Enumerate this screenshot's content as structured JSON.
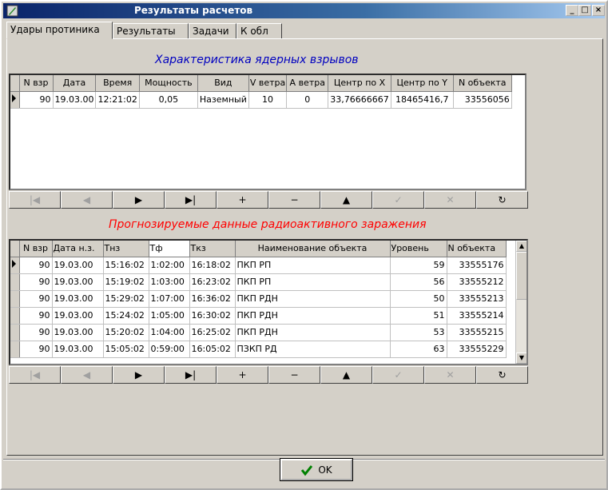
{
  "window": {
    "title": "Результаты расчетов"
  },
  "tabs": [
    {
      "label": "Удары протиника"
    },
    {
      "label": "Результаты"
    },
    {
      "label": "Задачи"
    },
    {
      "label": "К обл"
    }
  ],
  "explosions": {
    "title": "Характеристика ядерных взрывов",
    "title_color": "#0000c0",
    "columns": [
      "N взр",
      "Дата",
      "Время",
      "Мощность",
      "Вид",
      "V ветра",
      "A ветра",
      "Центр по X",
      "Центр по Y",
      "N объекта"
    ],
    "rows": [
      [
        "90",
        "19.03.00",
        "12:21:02",
        "0,05",
        "Наземный",
        "10",
        "0",
        "33,76666667",
        "18465416,7",
        "33556056"
      ]
    ]
  },
  "contamination": {
    "title": "Прогнозируемые данные радиоактивного заражения",
    "title_color": "#ff0000",
    "columns": [
      "N взр",
      "Дата н.з.",
      "Тнз",
      "Тф",
      "Ткз",
      "Наименование объекта",
      "Уровень",
      "N объекта"
    ],
    "rows": [
      [
        "90",
        "19.03.00",
        "15:16:02",
        "1:02:00",
        "16:18:02",
        "ПКП РП",
        "59",
        "33555176"
      ],
      [
        "90",
        "19.03.00",
        "15:19:02",
        "1:03:00",
        "16:23:02",
        "ПКП РП",
        "56",
        "33555212"
      ],
      [
        "90",
        "19.03.00",
        "15:29:02",
        "1:07:00",
        "16:36:02",
        "ПКП РДН",
        "50",
        "33555213"
      ],
      [
        "90",
        "19.03.00",
        "15:24:02",
        "1:05:00",
        "16:30:02",
        "ПКП РДН",
        "51",
        "33555214"
      ],
      [
        "90",
        "19.03.00",
        "15:20:02",
        "1:04:00",
        "16:25:02",
        "ПКП РДН",
        "53",
        "33555215"
      ],
      [
        "90",
        "19.03.00",
        "15:05:02",
        "0:59:00",
        "16:05:02",
        "ПЗКП РД",
        "63",
        "33555229"
      ]
    ]
  },
  "navigator": [
    {
      "name": "first-record-button",
      "glyph": "|◀",
      "enabled": false
    },
    {
      "name": "prior-record-button",
      "glyph": "◀",
      "enabled": false
    },
    {
      "name": "next-record-button",
      "glyph": "▶",
      "enabled": true
    },
    {
      "name": "last-record-button",
      "glyph": "▶|",
      "enabled": true
    },
    {
      "name": "insert-record-button",
      "glyph": "+",
      "enabled": true
    },
    {
      "name": "delete-record-button",
      "glyph": "−",
      "enabled": true
    },
    {
      "name": "edit-record-button",
      "glyph": "▲",
      "enabled": true
    },
    {
      "name": "post-edit-button",
      "glyph": "✓",
      "enabled": false
    },
    {
      "name": "cancel-edit-button",
      "glyph": "✕",
      "enabled": false
    },
    {
      "name": "refresh-button",
      "glyph": "↻",
      "enabled": true
    }
  ],
  "ok_button": {
    "label": "OK",
    "icon": "checkmark-icon"
  }
}
